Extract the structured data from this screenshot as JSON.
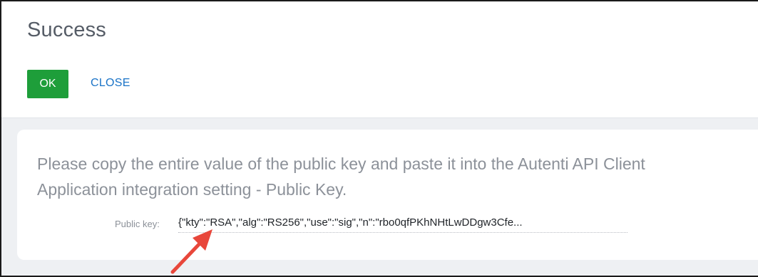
{
  "dialog": {
    "title": "Success",
    "ok_label": "OK",
    "close_label": "CLOSE"
  },
  "content": {
    "message": "Please copy the entire value of the public key and paste it into the Autenti API Client Application integration setting - Public Key.",
    "public_key_label": "Public key:",
    "public_key_value": "{\"kty\":\"RSA\",\"alg\":\"RS256\",\"use\":\"sig\",\"n\":\"rbo0qfPKhNHtLwDDgw3Cfe..."
  },
  "colors": {
    "ok_button": "#1e9e3a",
    "close_link": "#1a73c7",
    "annotation_arrow": "#e8473b"
  },
  "icons": {
    "annotation": "red-arrow-icon"
  }
}
